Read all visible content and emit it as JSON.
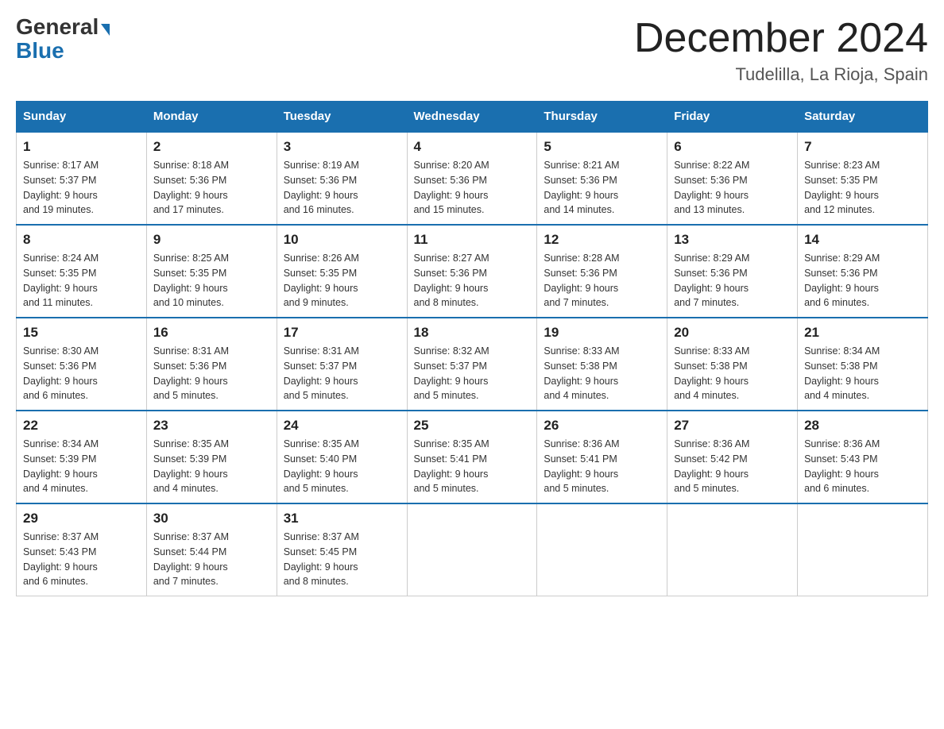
{
  "header": {
    "logo_general": "General",
    "logo_blue": "Blue",
    "month_title": "December 2024",
    "location": "Tudelilla, La Rioja, Spain"
  },
  "days_of_week": [
    "Sunday",
    "Monday",
    "Tuesday",
    "Wednesday",
    "Thursday",
    "Friday",
    "Saturday"
  ],
  "weeks": [
    [
      {
        "day": "1",
        "sunrise": "8:17 AM",
        "sunset": "5:37 PM",
        "daylight": "9 hours and 19 minutes."
      },
      {
        "day": "2",
        "sunrise": "8:18 AM",
        "sunset": "5:36 PM",
        "daylight": "9 hours and 17 minutes."
      },
      {
        "day": "3",
        "sunrise": "8:19 AM",
        "sunset": "5:36 PM",
        "daylight": "9 hours and 16 minutes."
      },
      {
        "day": "4",
        "sunrise": "8:20 AM",
        "sunset": "5:36 PM",
        "daylight": "9 hours and 15 minutes."
      },
      {
        "day": "5",
        "sunrise": "8:21 AM",
        "sunset": "5:36 PM",
        "daylight": "9 hours and 14 minutes."
      },
      {
        "day": "6",
        "sunrise": "8:22 AM",
        "sunset": "5:36 PM",
        "daylight": "9 hours and 13 minutes."
      },
      {
        "day": "7",
        "sunrise": "8:23 AM",
        "sunset": "5:35 PM",
        "daylight": "9 hours and 12 minutes."
      }
    ],
    [
      {
        "day": "8",
        "sunrise": "8:24 AM",
        "sunset": "5:35 PM",
        "daylight": "9 hours and 11 minutes."
      },
      {
        "day": "9",
        "sunrise": "8:25 AM",
        "sunset": "5:35 PM",
        "daylight": "9 hours and 10 minutes."
      },
      {
        "day": "10",
        "sunrise": "8:26 AM",
        "sunset": "5:35 PM",
        "daylight": "9 hours and 9 minutes."
      },
      {
        "day": "11",
        "sunrise": "8:27 AM",
        "sunset": "5:36 PM",
        "daylight": "9 hours and 8 minutes."
      },
      {
        "day": "12",
        "sunrise": "8:28 AM",
        "sunset": "5:36 PM",
        "daylight": "9 hours and 7 minutes."
      },
      {
        "day": "13",
        "sunrise": "8:29 AM",
        "sunset": "5:36 PM",
        "daylight": "9 hours and 7 minutes."
      },
      {
        "day": "14",
        "sunrise": "8:29 AM",
        "sunset": "5:36 PM",
        "daylight": "9 hours and 6 minutes."
      }
    ],
    [
      {
        "day": "15",
        "sunrise": "8:30 AM",
        "sunset": "5:36 PM",
        "daylight": "9 hours and 6 minutes."
      },
      {
        "day": "16",
        "sunrise": "8:31 AM",
        "sunset": "5:36 PM",
        "daylight": "9 hours and 5 minutes."
      },
      {
        "day": "17",
        "sunrise": "8:31 AM",
        "sunset": "5:37 PM",
        "daylight": "9 hours and 5 minutes."
      },
      {
        "day": "18",
        "sunrise": "8:32 AM",
        "sunset": "5:37 PM",
        "daylight": "9 hours and 5 minutes."
      },
      {
        "day": "19",
        "sunrise": "8:33 AM",
        "sunset": "5:38 PM",
        "daylight": "9 hours and 4 minutes."
      },
      {
        "day": "20",
        "sunrise": "8:33 AM",
        "sunset": "5:38 PM",
        "daylight": "9 hours and 4 minutes."
      },
      {
        "day": "21",
        "sunrise": "8:34 AM",
        "sunset": "5:38 PM",
        "daylight": "9 hours and 4 minutes."
      }
    ],
    [
      {
        "day": "22",
        "sunrise": "8:34 AM",
        "sunset": "5:39 PM",
        "daylight": "9 hours and 4 minutes."
      },
      {
        "day": "23",
        "sunrise": "8:35 AM",
        "sunset": "5:39 PM",
        "daylight": "9 hours and 4 minutes."
      },
      {
        "day": "24",
        "sunrise": "8:35 AM",
        "sunset": "5:40 PM",
        "daylight": "9 hours and 5 minutes."
      },
      {
        "day": "25",
        "sunrise": "8:35 AM",
        "sunset": "5:41 PM",
        "daylight": "9 hours and 5 minutes."
      },
      {
        "day": "26",
        "sunrise": "8:36 AM",
        "sunset": "5:41 PM",
        "daylight": "9 hours and 5 minutes."
      },
      {
        "day": "27",
        "sunrise": "8:36 AM",
        "sunset": "5:42 PM",
        "daylight": "9 hours and 5 minutes."
      },
      {
        "day": "28",
        "sunrise": "8:36 AM",
        "sunset": "5:43 PM",
        "daylight": "9 hours and 6 minutes."
      }
    ],
    [
      {
        "day": "29",
        "sunrise": "8:37 AM",
        "sunset": "5:43 PM",
        "daylight": "9 hours and 6 minutes."
      },
      {
        "day": "30",
        "sunrise": "8:37 AM",
        "sunset": "5:44 PM",
        "daylight": "9 hours and 7 minutes."
      },
      {
        "day": "31",
        "sunrise": "8:37 AM",
        "sunset": "5:45 PM",
        "daylight": "9 hours and 8 minutes."
      },
      null,
      null,
      null,
      null
    ]
  ],
  "labels": {
    "sunrise": "Sunrise:",
    "sunset": "Sunset:",
    "daylight": "Daylight:"
  }
}
